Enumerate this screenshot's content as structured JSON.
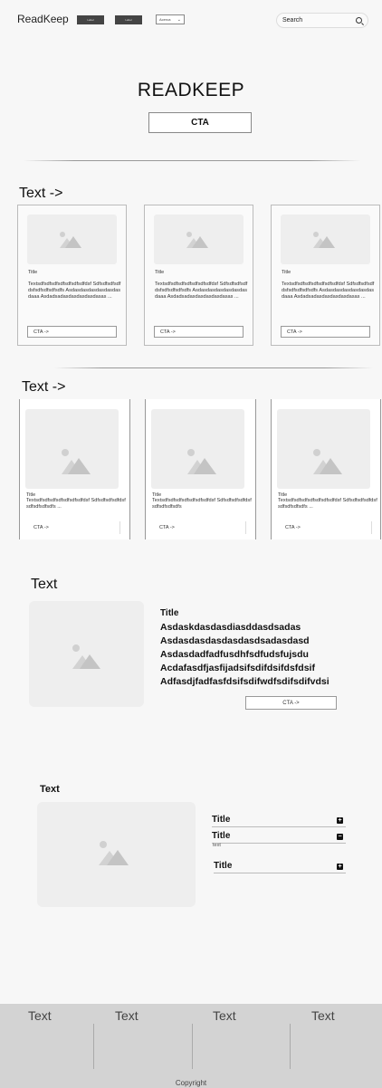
{
  "header": {
    "brand": "ReadKeep",
    "buttons": [
      "Label",
      "Label"
    ],
    "dropdown": {
      "value": "Acerca"
    },
    "search": {
      "placeholder": "Search"
    }
  },
  "hero": {
    "title": "READKEEP",
    "cta": "CTA"
  },
  "section1": {
    "heading": "Text ->",
    "cards": [
      {
        "title": "Title",
        "text": "Textsdfsdfsdfsdfsdfsdfsdfdsf Sdfsdfsdfsdfdsfsdfsdfsdfsdfs Asdasdasdasdasdasdasdaaa Asdadsadasdasdasdasdasas ...",
        "cta": "CTA ->"
      },
      {
        "title": "Title",
        "text": "Textsdfsdfsdfsdfsdfsdfsdfdsf Sdfsdfsdfsdfdsfsdfsdfsdfsdfs Asdasdasdasdasdasdasdaaa Asdadsadasdasdasdasdasas ...",
        "cta": "CTA ->"
      },
      {
        "title": "Title",
        "text": "Textsdfsdfsdfsdfsdfsdfsdfdsf Sdfsdfsdfsdfdsfsdfsdfsdfsdfs Asdasdasdasdasdasdasdaaa Asdadsadasdasdasdasdasas ...",
        "cta": "CTA ->"
      }
    ]
  },
  "section2": {
    "heading": "Text ->",
    "cards": [
      {
        "title": "Title",
        "text": "Textsdfsdfsdfsdfsdfsdfsdfdsf Sdfsdfsdfsdfdsfsdfsdfsdfsdfs ...",
        "cta": "CTA ->"
      },
      {
        "title": "Title",
        "text": "Textsdfsdfsdfsdfsdfsdfsdfdsf Sdfsdfsdfsdfdsfsdfsdfsdfsdfs",
        "cta": "CTA ->"
      },
      {
        "title": "Title",
        "text": "Textsdfsdfsdfsdfsdfsdfsdfdsf Sdfsdfsdfsdfdsfsdfsdfsdfsdfs ...",
        "cta": "CTA ->"
      }
    ]
  },
  "feature": {
    "heading": "Text",
    "title": "Title",
    "lines": [
      "Asdaskdasdasdiasddasdsadas",
      "Asdasdasdasdasdasdsadasdasd",
      "Asdasdadfadfusdhfsdfudsfujsdu",
      "Acdafasdfjasfijadsifsdifdsifdsfdsif",
      "Adfasdjfadfasfdsifsdifwdfsdifsdifvdsi"
    ],
    "cta": "CTA ->"
  },
  "accordion": {
    "heading": "Text",
    "items": [
      {
        "title": "Title",
        "icon": "plus-icon",
        "symbol": "+"
      },
      {
        "title": "Title",
        "icon": "minus-icon",
        "symbol": "−",
        "sub": "text"
      },
      {
        "title": "Title",
        "icon": "plus-icon",
        "symbol": "+"
      }
    ]
  },
  "footer": {
    "columns": [
      "Text",
      "Text",
      "Text",
      "Text"
    ],
    "copyright": "Copyright"
  }
}
